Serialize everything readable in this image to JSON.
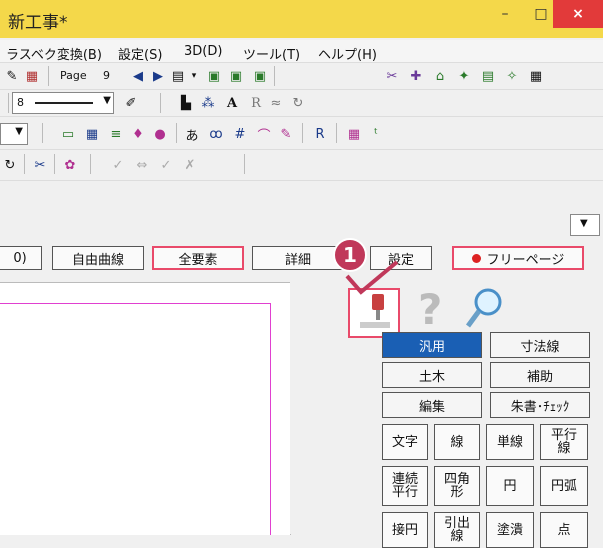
{
  "window": {
    "title": "新工事*",
    "min": "–",
    "max": "□",
    "close": "×"
  },
  "menu": [
    {
      "label": "ラスベク変換(B)"
    },
    {
      "label": "設定(S)"
    },
    {
      "label": "3D(D)"
    },
    {
      "label": "ツール(T)"
    },
    {
      "label": "ヘルプ(H)"
    }
  ],
  "toolbar1": {
    "page_label": "Page",
    "page_num": "9"
  },
  "toolbar2": {
    "line_combo": "8"
  },
  "buttons": {
    "b0": "0)",
    "b1": "自由曲線",
    "b2": "全要素",
    "b3": "詳細",
    "b4": "設定",
    "b5": "フリーページ"
  },
  "callout": {
    "number": "1"
  },
  "palette": {
    "tabs": [
      {
        "label": "汎用",
        "selected": true
      },
      {
        "label": "寸法線"
      },
      {
        "label": "土木"
      },
      {
        "label": "補助"
      },
      {
        "label": "編集"
      },
      {
        "label": "朱書･ﾁｪｯｸ"
      }
    ],
    "commands": [
      {
        "label": "文字"
      },
      {
        "label": "線"
      },
      {
        "label": "単線"
      },
      {
        "label": "平行線"
      },
      {
        "label": "連続平行"
      },
      {
        "label": "四角形"
      },
      {
        "label": "円"
      },
      {
        "label": "円弧"
      },
      {
        "label": "接円"
      },
      {
        "label": "引出線"
      },
      {
        "label": "塗潰"
      },
      {
        "label": "点"
      }
    ]
  },
  "icons": [
    "pin-icon",
    "help-icon",
    "magnifier-icon"
  ],
  "colors": {
    "title_bg": "#f4d84a",
    "close_bg": "#e23a3a",
    "selected": "#1a5fb4",
    "highlight": "#e94a6a",
    "callout": "#c0385a"
  }
}
